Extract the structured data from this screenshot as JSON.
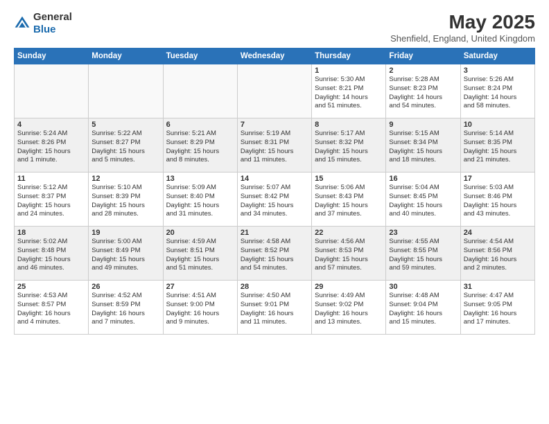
{
  "header": {
    "logo": {
      "line1": "General",
      "line2": "Blue"
    },
    "title": "May 2025",
    "location": "Shenfield, England, United Kingdom"
  },
  "days_header": [
    "Sunday",
    "Monday",
    "Tuesday",
    "Wednesday",
    "Thursday",
    "Friday",
    "Saturday"
  ],
  "weeks": [
    [
      {
        "day": "",
        "info": ""
      },
      {
        "day": "",
        "info": ""
      },
      {
        "day": "",
        "info": ""
      },
      {
        "day": "",
        "info": ""
      },
      {
        "day": "1",
        "info": "Sunrise: 5:30 AM\nSunset: 8:21 PM\nDaylight: 14 hours\nand 51 minutes."
      },
      {
        "day": "2",
        "info": "Sunrise: 5:28 AM\nSunset: 8:23 PM\nDaylight: 14 hours\nand 54 minutes."
      },
      {
        "day": "3",
        "info": "Sunrise: 5:26 AM\nSunset: 8:24 PM\nDaylight: 14 hours\nand 58 minutes."
      }
    ],
    [
      {
        "day": "4",
        "info": "Sunrise: 5:24 AM\nSunset: 8:26 PM\nDaylight: 15 hours\nand 1 minute."
      },
      {
        "day": "5",
        "info": "Sunrise: 5:22 AM\nSunset: 8:27 PM\nDaylight: 15 hours\nand 5 minutes."
      },
      {
        "day": "6",
        "info": "Sunrise: 5:21 AM\nSunset: 8:29 PM\nDaylight: 15 hours\nand 8 minutes."
      },
      {
        "day": "7",
        "info": "Sunrise: 5:19 AM\nSunset: 8:31 PM\nDaylight: 15 hours\nand 11 minutes."
      },
      {
        "day": "8",
        "info": "Sunrise: 5:17 AM\nSunset: 8:32 PM\nDaylight: 15 hours\nand 15 minutes."
      },
      {
        "day": "9",
        "info": "Sunrise: 5:15 AM\nSunset: 8:34 PM\nDaylight: 15 hours\nand 18 minutes."
      },
      {
        "day": "10",
        "info": "Sunrise: 5:14 AM\nSunset: 8:35 PM\nDaylight: 15 hours\nand 21 minutes."
      }
    ],
    [
      {
        "day": "11",
        "info": "Sunrise: 5:12 AM\nSunset: 8:37 PM\nDaylight: 15 hours\nand 24 minutes."
      },
      {
        "day": "12",
        "info": "Sunrise: 5:10 AM\nSunset: 8:39 PM\nDaylight: 15 hours\nand 28 minutes."
      },
      {
        "day": "13",
        "info": "Sunrise: 5:09 AM\nSunset: 8:40 PM\nDaylight: 15 hours\nand 31 minutes."
      },
      {
        "day": "14",
        "info": "Sunrise: 5:07 AM\nSunset: 8:42 PM\nDaylight: 15 hours\nand 34 minutes."
      },
      {
        "day": "15",
        "info": "Sunrise: 5:06 AM\nSunset: 8:43 PM\nDaylight: 15 hours\nand 37 minutes."
      },
      {
        "day": "16",
        "info": "Sunrise: 5:04 AM\nSunset: 8:45 PM\nDaylight: 15 hours\nand 40 minutes."
      },
      {
        "day": "17",
        "info": "Sunrise: 5:03 AM\nSunset: 8:46 PM\nDaylight: 15 hours\nand 43 minutes."
      }
    ],
    [
      {
        "day": "18",
        "info": "Sunrise: 5:02 AM\nSunset: 8:48 PM\nDaylight: 15 hours\nand 46 minutes."
      },
      {
        "day": "19",
        "info": "Sunrise: 5:00 AM\nSunset: 8:49 PM\nDaylight: 15 hours\nand 49 minutes."
      },
      {
        "day": "20",
        "info": "Sunrise: 4:59 AM\nSunset: 8:51 PM\nDaylight: 15 hours\nand 51 minutes."
      },
      {
        "day": "21",
        "info": "Sunrise: 4:58 AM\nSunset: 8:52 PM\nDaylight: 15 hours\nand 54 minutes."
      },
      {
        "day": "22",
        "info": "Sunrise: 4:56 AM\nSunset: 8:53 PM\nDaylight: 15 hours\nand 57 minutes."
      },
      {
        "day": "23",
        "info": "Sunrise: 4:55 AM\nSunset: 8:55 PM\nDaylight: 15 hours\nand 59 minutes."
      },
      {
        "day": "24",
        "info": "Sunrise: 4:54 AM\nSunset: 8:56 PM\nDaylight: 16 hours\nand 2 minutes."
      }
    ],
    [
      {
        "day": "25",
        "info": "Sunrise: 4:53 AM\nSunset: 8:57 PM\nDaylight: 16 hours\nand 4 minutes."
      },
      {
        "day": "26",
        "info": "Sunrise: 4:52 AM\nSunset: 8:59 PM\nDaylight: 16 hours\nand 7 minutes."
      },
      {
        "day": "27",
        "info": "Sunrise: 4:51 AM\nSunset: 9:00 PM\nDaylight: 16 hours\nand 9 minutes."
      },
      {
        "day": "28",
        "info": "Sunrise: 4:50 AM\nSunset: 9:01 PM\nDaylight: 16 hours\nand 11 minutes."
      },
      {
        "day": "29",
        "info": "Sunrise: 4:49 AM\nSunset: 9:02 PM\nDaylight: 16 hours\nand 13 minutes."
      },
      {
        "day": "30",
        "info": "Sunrise: 4:48 AM\nSunset: 9:04 PM\nDaylight: 16 hours\nand 15 minutes."
      },
      {
        "day": "31",
        "info": "Sunrise: 4:47 AM\nSunset: 9:05 PM\nDaylight: 16 hours\nand 17 minutes."
      }
    ]
  ]
}
